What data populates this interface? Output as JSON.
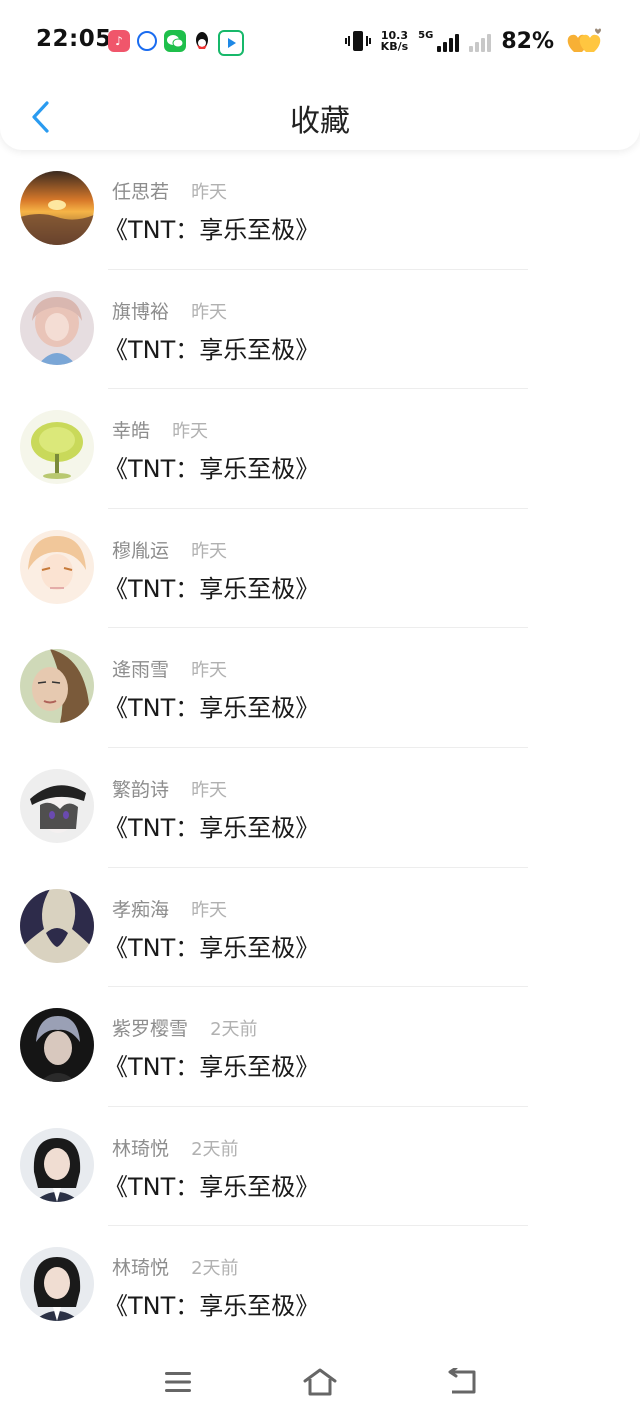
{
  "status_bar": {
    "time": "22:05",
    "net_speed_value": "10.3",
    "net_speed_unit": "KB/s",
    "network_type": "5G",
    "battery_percent": "82%",
    "app_icons": [
      "music-app-icon",
      "browser-app-icon",
      "wechat-app-icon",
      "qq-app-icon",
      "video-app-icon"
    ]
  },
  "titlebar": {
    "title": "收藏",
    "back_icon": "chevron-left-icon",
    "accent_color": "#2a9bf0"
  },
  "favorites": [
    {
      "name": "任思若",
      "time": "昨天",
      "content": "《TNT：享乐至极》",
      "avatar": "sunset-avatar"
    },
    {
      "name": "旗博裕",
      "time": "昨天",
      "content": "《TNT：享乐至极》",
      "avatar": "girl-avatar"
    },
    {
      "name": "幸皓",
      "time": "昨天",
      "content": "《TNT：享乐至极》",
      "avatar": "tree-avatar"
    },
    {
      "name": "穆胤运",
      "time": "昨天",
      "content": "《TNT：享乐至极》",
      "avatar": "anime-avatar"
    },
    {
      "name": "逄雨雪",
      "time": "昨天",
      "content": "《TNT：享乐至极》",
      "avatar": "portrait-avatar"
    },
    {
      "name": "繁韵诗",
      "time": "昨天",
      "content": "《TNT：享乐至极》",
      "avatar": "anime-cap-avatar"
    },
    {
      "name": "孝痴海",
      "time": "昨天",
      "content": "《TNT：享乐至极》",
      "avatar": "silhouette-avatar"
    },
    {
      "name": "紫罗樱雪",
      "time": "2天前",
      "content": "《TNT：享乐至极》",
      "avatar": "dark-portrait-avatar"
    },
    {
      "name": "林琦悦",
      "time": "2天前",
      "content": "《TNT：享乐至极》",
      "avatar": "student-avatar"
    },
    {
      "name": "林琦悦",
      "time": "2天前",
      "content": "《TNT：享乐至极》",
      "avatar": "student-avatar"
    }
  ],
  "navbar": {
    "icons": [
      "menu-icon",
      "home-icon",
      "back-icon"
    ]
  }
}
